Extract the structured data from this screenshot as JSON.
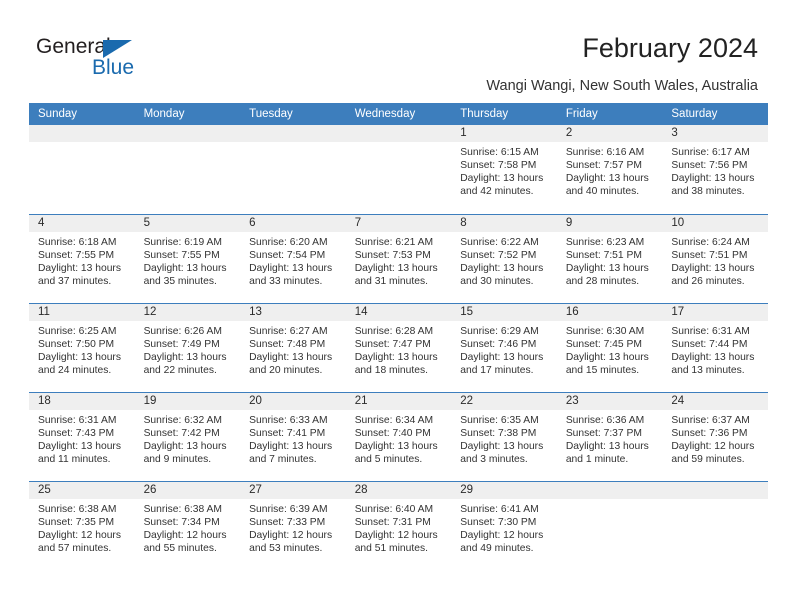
{
  "logo": {
    "text_primary": "General",
    "text_secondary": "Blue",
    "primary_color": "#231f20",
    "accent_color": "#1a6aae"
  },
  "header": {
    "title": "February 2024",
    "subtitle": "Wangi Wangi, New South Wales, Australia"
  },
  "theme": {
    "header_row_bg": "#3d7ebd",
    "daynum_band_bg": "#efefef",
    "row_separator": "#3d7ebd",
    "text_color": "#333333"
  },
  "calendar": {
    "weekday_headers": [
      "Sunday",
      "Monday",
      "Tuesday",
      "Wednesday",
      "Thursday",
      "Friday",
      "Saturday"
    ],
    "weeks": [
      [
        {
          "day": "",
          "empty": true,
          "sunrise": "",
          "sunset": "",
          "daylight_line1": "",
          "daylight_line2": ""
        },
        {
          "day": "",
          "empty": true,
          "sunrise": "",
          "sunset": "",
          "daylight_line1": "",
          "daylight_line2": ""
        },
        {
          "day": "",
          "empty": true,
          "sunrise": "",
          "sunset": "",
          "daylight_line1": "",
          "daylight_line2": ""
        },
        {
          "day": "",
          "empty": true,
          "sunrise": "",
          "sunset": "",
          "daylight_line1": "",
          "daylight_line2": ""
        },
        {
          "day": "1",
          "empty": false,
          "sunrise": "Sunrise: 6:15 AM",
          "sunset": "Sunset: 7:58 PM",
          "daylight_line1": "Daylight: 13 hours",
          "daylight_line2": "and 42 minutes."
        },
        {
          "day": "2",
          "empty": false,
          "sunrise": "Sunrise: 6:16 AM",
          "sunset": "Sunset: 7:57 PM",
          "daylight_line1": "Daylight: 13 hours",
          "daylight_line2": "and 40 minutes."
        },
        {
          "day": "3",
          "empty": false,
          "sunrise": "Sunrise: 6:17 AM",
          "sunset": "Sunset: 7:56 PM",
          "daylight_line1": "Daylight: 13 hours",
          "daylight_line2": "and 38 minutes."
        }
      ],
      [
        {
          "day": "4",
          "empty": false,
          "sunrise": "Sunrise: 6:18 AM",
          "sunset": "Sunset: 7:55 PM",
          "daylight_line1": "Daylight: 13 hours",
          "daylight_line2": "and 37 minutes."
        },
        {
          "day": "5",
          "empty": false,
          "sunrise": "Sunrise: 6:19 AM",
          "sunset": "Sunset: 7:55 PM",
          "daylight_line1": "Daylight: 13 hours",
          "daylight_line2": "and 35 minutes."
        },
        {
          "day": "6",
          "empty": false,
          "sunrise": "Sunrise: 6:20 AM",
          "sunset": "Sunset: 7:54 PM",
          "daylight_line1": "Daylight: 13 hours",
          "daylight_line2": "and 33 minutes."
        },
        {
          "day": "7",
          "empty": false,
          "sunrise": "Sunrise: 6:21 AM",
          "sunset": "Sunset: 7:53 PM",
          "daylight_line1": "Daylight: 13 hours",
          "daylight_line2": "and 31 minutes."
        },
        {
          "day": "8",
          "empty": false,
          "sunrise": "Sunrise: 6:22 AM",
          "sunset": "Sunset: 7:52 PM",
          "daylight_line1": "Daylight: 13 hours",
          "daylight_line2": "and 30 minutes."
        },
        {
          "day": "9",
          "empty": false,
          "sunrise": "Sunrise: 6:23 AM",
          "sunset": "Sunset: 7:51 PM",
          "daylight_line1": "Daylight: 13 hours",
          "daylight_line2": "and 28 minutes."
        },
        {
          "day": "10",
          "empty": false,
          "sunrise": "Sunrise: 6:24 AM",
          "sunset": "Sunset: 7:51 PM",
          "daylight_line1": "Daylight: 13 hours",
          "daylight_line2": "and 26 minutes."
        }
      ],
      [
        {
          "day": "11",
          "empty": false,
          "sunrise": "Sunrise: 6:25 AM",
          "sunset": "Sunset: 7:50 PM",
          "daylight_line1": "Daylight: 13 hours",
          "daylight_line2": "and 24 minutes."
        },
        {
          "day": "12",
          "empty": false,
          "sunrise": "Sunrise: 6:26 AM",
          "sunset": "Sunset: 7:49 PM",
          "daylight_line1": "Daylight: 13 hours",
          "daylight_line2": "and 22 minutes."
        },
        {
          "day": "13",
          "empty": false,
          "sunrise": "Sunrise: 6:27 AM",
          "sunset": "Sunset: 7:48 PM",
          "daylight_line1": "Daylight: 13 hours",
          "daylight_line2": "and 20 minutes."
        },
        {
          "day": "14",
          "empty": false,
          "sunrise": "Sunrise: 6:28 AM",
          "sunset": "Sunset: 7:47 PM",
          "daylight_line1": "Daylight: 13 hours",
          "daylight_line2": "and 18 minutes."
        },
        {
          "day": "15",
          "empty": false,
          "sunrise": "Sunrise: 6:29 AM",
          "sunset": "Sunset: 7:46 PM",
          "daylight_line1": "Daylight: 13 hours",
          "daylight_line2": "and 17 minutes."
        },
        {
          "day": "16",
          "empty": false,
          "sunrise": "Sunrise: 6:30 AM",
          "sunset": "Sunset: 7:45 PM",
          "daylight_line1": "Daylight: 13 hours",
          "daylight_line2": "and 15 minutes."
        },
        {
          "day": "17",
          "empty": false,
          "sunrise": "Sunrise: 6:31 AM",
          "sunset": "Sunset: 7:44 PM",
          "daylight_line1": "Daylight: 13 hours",
          "daylight_line2": "and 13 minutes."
        }
      ],
      [
        {
          "day": "18",
          "empty": false,
          "sunrise": "Sunrise: 6:31 AM",
          "sunset": "Sunset: 7:43 PM",
          "daylight_line1": "Daylight: 13 hours",
          "daylight_line2": "and 11 minutes."
        },
        {
          "day": "19",
          "empty": false,
          "sunrise": "Sunrise: 6:32 AM",
          "sunset": "Sunset: 7:42 PM",
          "daylight_line1": "Daylight: 13 hours",
          "daylight_line2": "and 9 minutes."
        },
        {
          "day": "20",
          "empty": false,
          "sunrise": "Sunrise: 6:33 AM",
          "sunset": "Sunset: 7:41 PM",
          "daylight_line1": "Daylight: 13 hours",
          "daylight_line2": "and 7 minutes."
        },
        {
          "day": "21",
          "empty": false,
          "sunrise": "Sunrise: 6:34 AM",
          "sunset": "Sunset: 7:40 PM",
          "daylight_line1": "Daylight: 13 hours",
          "daylight_line2": "and 5 minutes."
        },
        {
          "day": "22",
          "empty": false,
          "sunrise": "Sunrise: 6:35 AM",
          "sunset": "Sunset: 7:38 PM",
          "daylight_line1": "Daylight: 13 hours",
          "daylight_line2": "and 3 minutes."
        },
        {
          "day": "23",
          "empty": false,
          "sunrise": "Sunrise: 6:36 AM",
          "sunset": "Sunset: 7:37 PM",
          "daylight_line1": "Daylight: 13 hours",
          "daylight_line2": "and 1 minute."
        },
        {
          "day": "24",
          "empty": false,
          "sunrise": "Sunrise: 6:37 AM",
          "sunset": "Sunset: 7:36 PM",
          "daylight_line1": "Daylight: 12 hours",
          "daylight_line2": "and 59 minutes."
        }
      ],
      [
        {
          "day": "25",
          "empty": false,
          "sunrise": "Sunrise: 6:38 AM",
          "sunset": "Sunset: 7:35 PM",
          "daylight_line1": "Daylight: 12 hours",
          "daylight_line2": "and 57 minutes."
        },
        {
          "day": "26",
          "empty": false,
          "sunrise": "Sunrise: 6:38 AM",
          "sunset": "Sunset: 7:34 PM",
          "daylight_line1": "Daylight: 12 hours",
          "daylight_line2": "and 55 minutes."
        },
        {
          "day": "27",
          "empty": false,
          "sunrise": "Sunrise: 6:39 AM",
          "sunset": "Sunset: 7:33 PM",
          "daylight_line1": "Daylight: 12 hours",
          "daylight_line2": "and 53 minutes."
        },
        {
          "day": "28",
          "empty": false,
          "sunrise": "Sunrise: 6:40 AM",
          "sunset": "Sunset: 7:31 PM",
          "daylight_line1": "Daylight: 12 hours",
          "daylight_line2": "and 51 minutes."
        },
        {
          "day": "29",
          "empty": false,
          "sunrise": "Sunrise: 6:41 AM",
          "sunset": "Sunset: 7:30 PM",
          "daylight_line1": "Daylight: 12 hours",
          "daylight_line2": "and 49 minutes."
        },
        {
          "day": "",
          "empty": true,
          "sunrise": "",
          "sunset": "",
          "daylight_line1": "",
          "daylight_line2": ""
        },
        {
          "day": "",
          "empty": true,
          "sunrise": "",
          "sunset": "",
          "daylight_line1": "",
          "daylight_line2": ""
        }
      ]
    ]
  }
}
